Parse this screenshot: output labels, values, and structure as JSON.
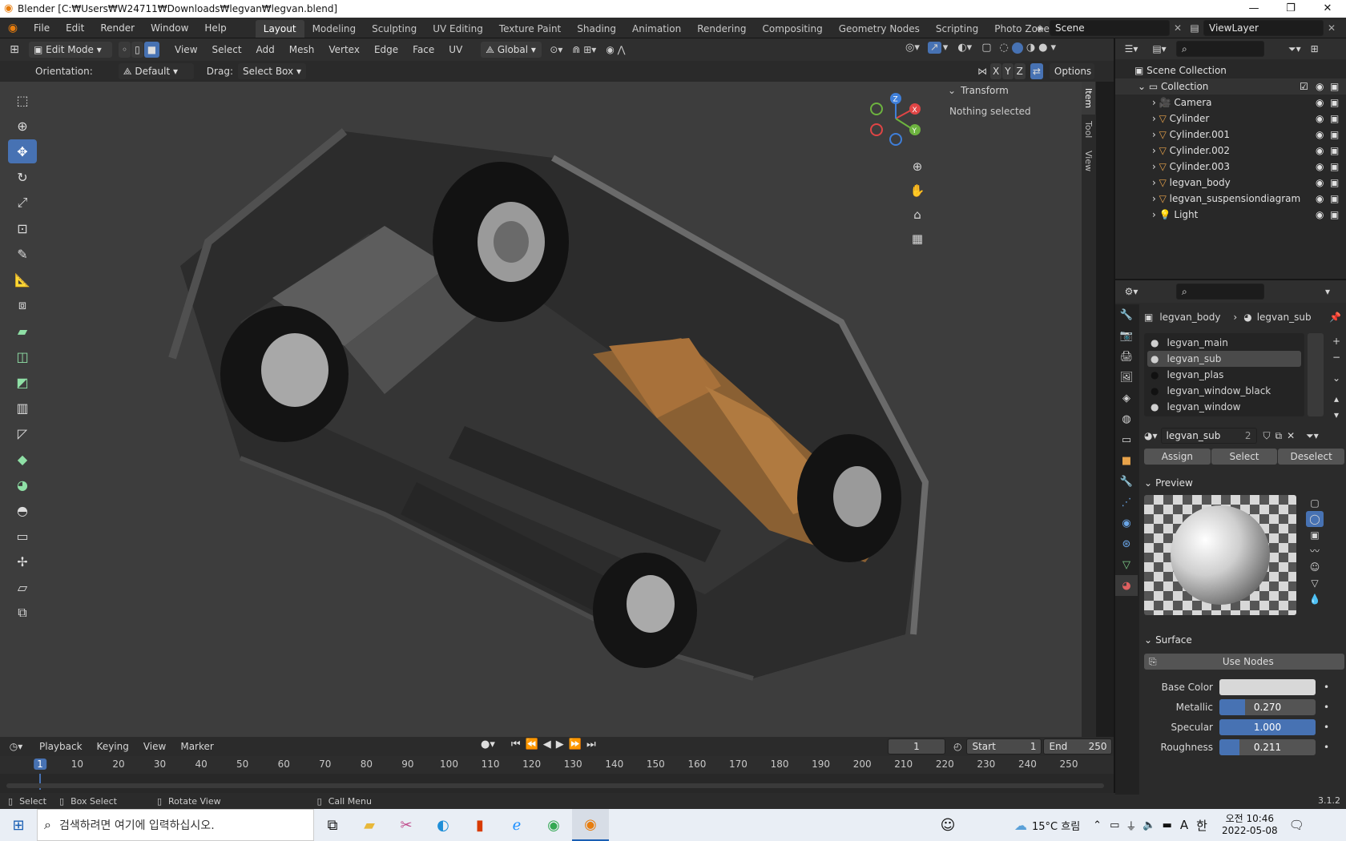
{
  "window": {
    "title": "Blender [C:₩Users₩W24711₩Downloads₩legvan₩legvan.blend]",
    "minimize": "—",
    "maximize": "❐",
    "close": "✕"
  },
  "menus": [
    "File",
    "Edit",
    "Render",
    "Window",
    "Help"
  ],
  "workspaces": [
    {
      "label": "Layout",
      "active": true
    },
    {
      "label": "Modeling"
    },
    {
      "label": "Sculpting"
    },
    {
      "label": "UV Editing"
    },
    {
      "label": "Texture Paint"
    },
    {
      "label": "Shading"
    },
    {
      "label": "Animation"
    },
    {
      "label": "Rendering"
    },
    {
      "label": "Compositing"
    },
    {
      "label": "Geometry Nodes"
    },
    {
      "label": "Scripting"
    },
    {
      "label": "Photo Zone"
    }
  ],
  "add_workspace": "+",
  "scene": {
    "label": "Scene",
    "viewlayer": "ViewLayer"
  },
  "header": {
    "mode": "Edit Mode",
    "menus": [
      "View",
      "Select",
      "Add",
      "Mesh",
      "Vertex",
      "Edge",
      "Face",
      "UV"
    ],
    "transform_orientation": "Global"
  },
  "toolheader": {
    "orientation_label": "Orientation:",
    "orientation_value": "Default",
    "drag_label": "Drag:",
    "drag_value": "Select Box",
    "axes": [
      "X",
      "Y",
      "Z"
    ],
    "options": "Options"
  },
  "npanel": {
    "section": "Transform",
    "message": "Nothing selected",
    "tabs": [
      "Item",
      "Tool",
      "View"
    ]
  },
  "gizmo": {
    "x": "X",
    "y": "Y",
    "z": "Z"
  },
  "outliner": {
    "root": "Scene Collection",
    "collection": "Collection",
    "items": [
      {
        "name": "Camera",
        "icon": "camera-icon"
      },
      {
        "name": "Cylinder",
        "icon": "mesh-icon"
      },
      {
        "name": "Cylinder.001",
        "icon": "mesh-icon"
      },
      {
        "name": "Cylinder.002",
        "icon": "mesh-icon"
      },
      {
        "name": "Cylinder.003",
        "icon": "mesh-icon"
      },
      {
        "name": "legvan_body",
        "icon": "mesh-icon"
      },
      {
        "name": "legvan_suspensiondiagram",
        "icon": "mesh-icon"
      },
      {
        "name": "Light",
        "icon": "light-icon"
      }
    ]
  },
  "properties": {
    "breadcrumb_object": "legvan_body",
    "breadcrumb_material": "legvan_sub",
    "slots": [
      {
        "name": "legvan_main"
      },
      {
        "name": "legvan_sub",
        "selected": true
      },
      {
        "name": "legvan_plas"
      },
      {
        "name": "legvan_window_black"
      },
      {
        "name": "legvan_window"
      }
    ],
    "material_name": "legvan_sub",
    "users": "2",
    "assign": "Assign",
    "select": "Select",
    "deselect": "Deselect",
    "preview_label": "Preview",
    "surface_label": "Surface",
    "use_nodes": "Use Nodes",
    "base_color_label": "Base Color",
    "base_color": "#d8d8d8",
    "metallic_label": "Metallic",
    "metallic": "0.270",
    "metallic_fraction": 0.27,
    "specular_label": "Specular",
    "specular": "1.000",
    "specular_fraction": 1.0,
    "roughness_label": "Roughness",
    "roughness": "0.211",
    "roughness_fraction": 0.211
  },
  "timeline": {
    "menus": [
      "Playback",
      "Keying",
      "View",
      "Marker"
    ],
    "current_frame": "1",
    "start_label": "Start",
    "start": "1",
    "end_label": "End",
    "end": "250",
    "ticks": [
      "1",
      "10",
      "20",
      "30",
      "40",
      "50",
      "60",
      "70",
      "80",
      "90",
      "100",
      "110",
      "120",
      "130",
      "140",
      "150",
      "160",
      "170",
      "180",
      "190",
      "200",
      "210",
      "220",
      "230",
      "240",
      "250"
    ]
  },
  "statusbar": {
    "select": "Select",
    "box_select": "Box Select",
    "rotate": "Rotate View",
    "call_menu": "Call Menu",
    "version": "3.1.2"
  },
  "taskbar": {
    "search_placeholder": "검색하려면 여기에 입력하십시오.",
    "weather": "15°C 흐림",
    "ime_a": "A",
    "ime_han": "한",
    "time": "오전 10:46",
    "date": "2022-05-08"
  },
  "colors": {
    "accent": "#4772b3",
    "body_orange": "#a8713a"
  }
}
